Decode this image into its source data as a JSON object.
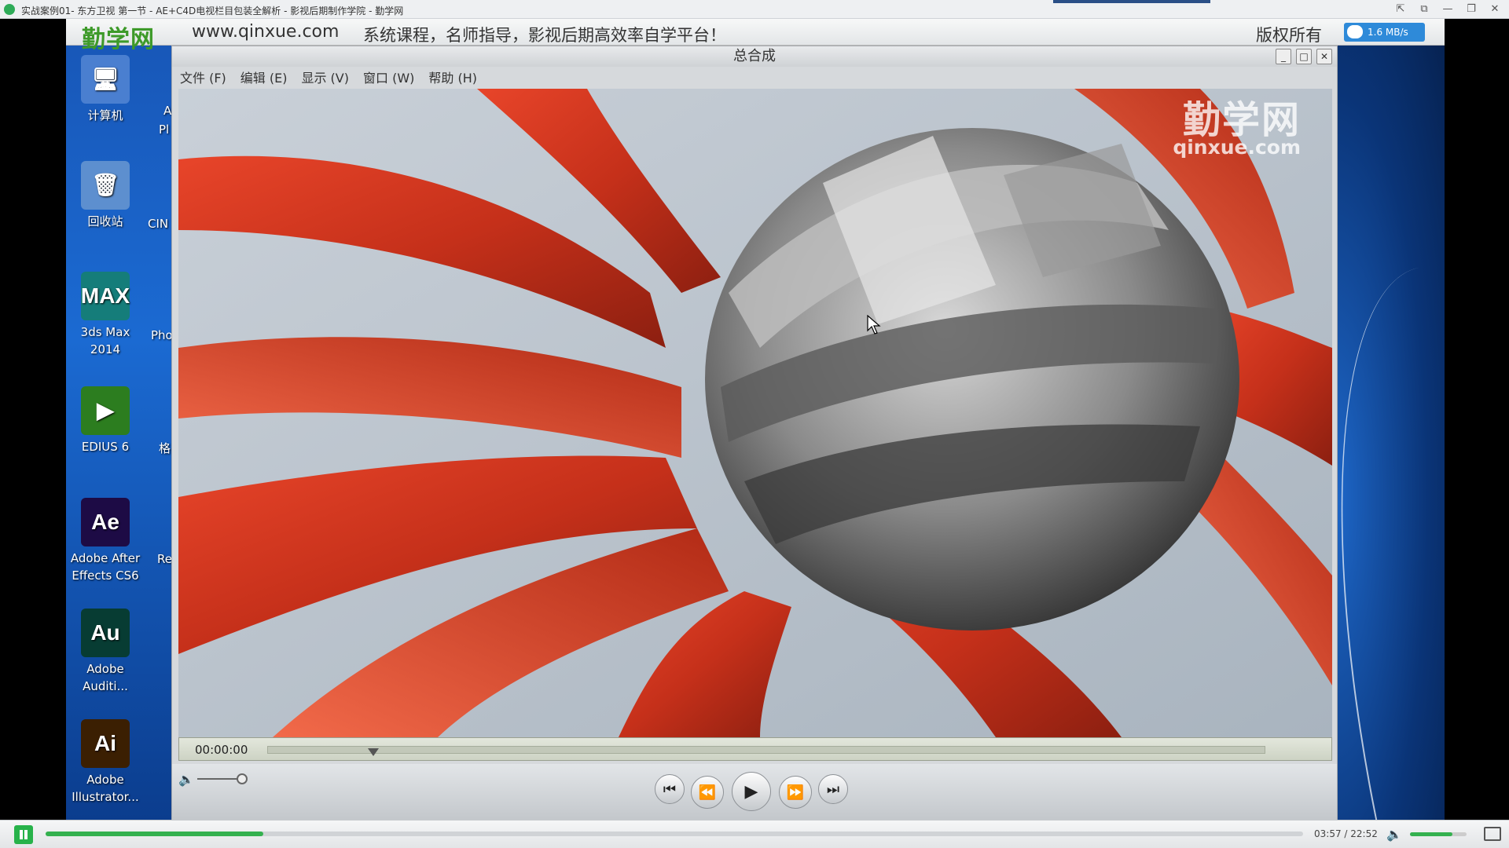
{
  "window": {
    "title": "实战案例01- 东方卫视 第一节 - AE+C4D电视栏目包装全解析 - 影视后期制作学院 - 勤学网",
    "controls": [
      "⇱",
      "⧉",
      "—",
      "❐",
      "✕"
    ]
  },
  "banner": {
    "logo": "勤学网",
    "site": "www.qinxue.com",
    "slogan": "系统课程，名师指导，影视后期高效率自学平台！",
    "rights": "版权所有",
    "speed": "1.6 MB/s"
  },
  "desktop_icons": [
    {
      "label": "计算机",
      "glyph": "🖥",
      "color": "#4a7fd0"
    },
    {
      "label": "回收站",
      "glyph": "🗑",
      "color": "#5d8fcf"
    },
    {
      "label": "3ds Max\n2014",
      "glyph": "MAX",
      "color": "#157d7a"
    },
    {
      "label": "EDIUS 6",
      "glyph": "▶",
      "color": "#2c7d1f"
    },
    {
      "label": "Adobe After\nEffects CS6",
      "glyph": "Ae",
      "color": "#1d0b45"
    },
    {
      "label": "Adobe\nAuditi...",
      "glyph": "Au",
      "color": "#073c33"
    },
    {
      "label": "Adobe\nIllustrator...",
      "glyph": "Ai",
      "color": "#3b1f02"
    }
  ],
  "desktop_partial_labels": [
    "A",
    "Pl",
    "CIN",
    "Pho",
    "格",
    "Re"
  ],
  "composition": {
    "title": "总合成",
    "menu": [
      "文件 (F)",
      "编辑 (E)",
      "显示 (V)",
      "窗口 (W)",
      "帮助 (H)"
    ],
    "controls": [
      "_",
      "□",
      "✕"
    ],
    "watermark_cn": "勤学网",
    "watermark_en": "qinxue.com",
    "timecode": "00:00:00",
    "timeline_position": 0.1
  },
  "player": {
    "elapsed": "03:57",
    "total": "22:52",
    "time_display": "03:57 / 22:52",
    "progress": 0.173,
    "volume": 0.75
  },
  "colors": {
    "accent": "#34b14f",
    "ribbon": "#d8381f",
    "sphere": "#7a7a7a"
  }
}
